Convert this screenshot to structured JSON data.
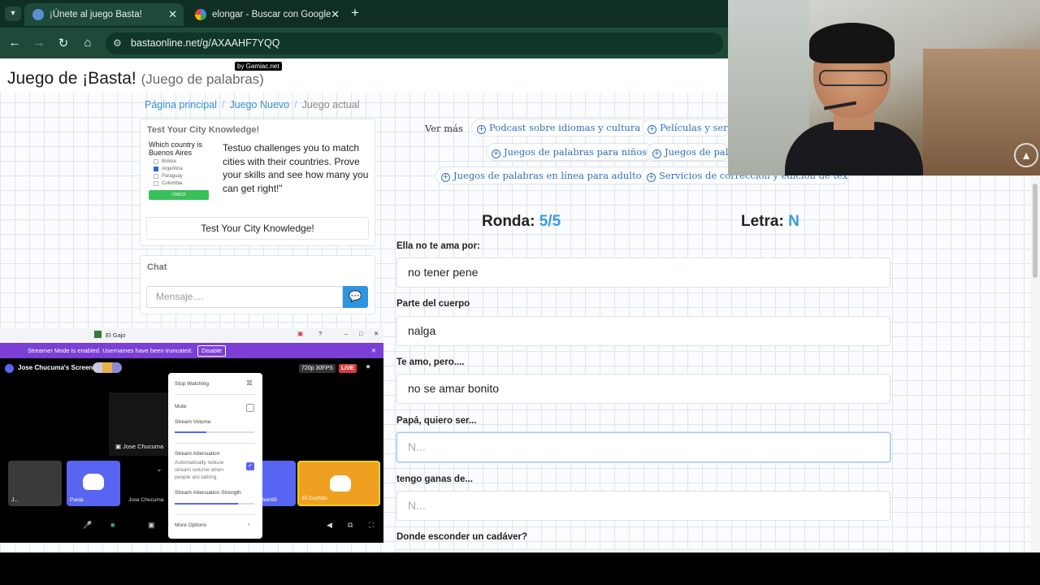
{
  "browser": {
    "tabs": [
      {
        "title": "¡Únete al juego Basta!",
        "active": true
      },
      {
        "title": "elongar - Buscar con Google",
        "active": false
      }
    ],
    "url": "bastaonline.net/g/AXAAHF7YQQ"
  },
  "header": {
    "title": "Juego de ¡Basta!",
    "subtitle": "(Juego de palabras)",
    "badge": "by Gamiac.net"
  },
  "breadcrumb": {
    "home": "Página principal",
    "new_game": "Juego Nuevo",
    "current": "Juego actual"
  },
  "ad": {
    "heading": "Test Your City Knowledge!",
    "quiz_question": "Which country is Buenos Aires",
    "quiz_options": [
      "Bolivia",
      "Argentina",
      "Paraguay",
      "Colombia"
    ],
    "quiz_check": "CHECK",
    "text": "Testuo challenges you to match cities with their countries. Prove your skills and see how many you can get right!\"",
    "button": "Test Your City Knowledge!"
  },
  "chat": {
    "heading": "Chat",
    "placeholder": "Mensaje...."
  },
  "links": {
    "ver_mas": "Ver más",
    "items": [
      "Podcast sobre idiomas y cultura",
      "Películas y seri",
      "Juegos de palabras para niños",
      "Juegos de pala",
      "Juegos de palabras en línea para adultos",
      "Servicios de corrección y edición de textos"
    ]
  },
  "game": {
    "round_label": "Ronda:",
    "round_value": "5/5",
    "letter_label": "Letra:",
    "letter_value": "N",
    "questions": [
      {
        "label": "Ella no te ama por:",
        "value": "no tener pene",
        "placeholder": ""
      },
      {
        "label": "Parte del cuerpo",
        "value": "nalga",
        "placeholder": ""
      },
      {
        "label": "Te amo, pero....",
        "value": "no se amar bonito",
        "placeholder": ""
      },
      {
        "label": "Papá, quiero ser...",
        "value": "",
        "placeholder": "N..."
      },
      {
        "label": "tengo ganas de...",
        "value": "",
        "placeholder": "N..."
      },
      {
        "label": "Donde esconder un cadáver?",
        "value": "",
        "placeholder": ""
      }
    ]
  },
  "discord": {
    "window_title": "El Gajo",
    "banner": "Streamer Mode is enabled. Usernames have been truncated.",
    "banner_button": "Disable",
    "screen_label": "Jose Chucuma's Screen",
    "quality": "720p 30FPS",
    "live": "LIVE",
    "stream_owner": "Jose Chucuma",
    "participants": [
      "J...",
      "Paola",
      "Jose Chucuma",
      "...lein99",
      "El Cochillo"
    ],
    "menu": {
      "stop": "Stop Watching",
      "mute": "Mute",
      "volume": "Stream Volume",
      "volume_level": 0.4,
      "attenuation": "Stream Attenuation",
      "attenuation_desc": "Automatically reduce stream volume when people are talking.",
      "attenuation_strength": "Stream Attenuation Strength",
      "strength_level": 0.8,
      "more": "More Options"
    }
  },
  "colors": {
    "accent": "#3a9be0",
    "link": "#2a6fc0",
    "discord": "#5865f2",
    "streamer_banner": "#7c3fd6"
  }
}
